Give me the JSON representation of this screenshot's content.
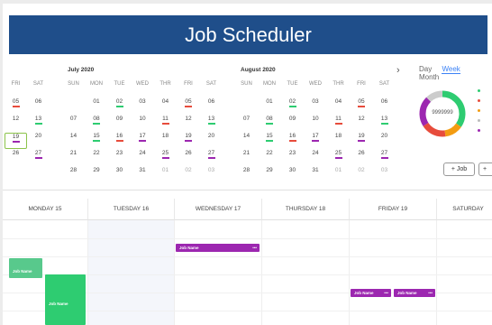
{
  "banner": {
    "title": "Job Scheduler"
  },
  "calendar": {
    "prev_partial_month": {
      "weekdays": [
        "FRI",
        "SAT"
      ],
      "rows": [
        [
          "05",
          "06"
        ],
        [
          "12",
          "13"
        ],
        [
          "19",
          "20"
        ],
        [
          "26",
          "27"
        ]
      ]
    },
    "july": {
      "title": "July 2020",
      "weekdays": [
        "SUN",
        "MON",
        "TUE",
        "WED",
        "THR",
        "FRI",
        "SAT"
      ],
      "rows": [
        [
          "",
          "01",
          "02",
          "03",
          "04",
          "05",
          "06"
        ],
        [
          "07",
          "08",
          "09",
          "10",
          "11",
          "12",
          "13"
        ],
        [
          "14",
          "15",
          "16",
          "17",
          "18",
          "19",
          "20"
        ],
        [
          "21",
          "22",
          "23",
          "24",
          "25",
          "26",
          "27"
        ],
        [
          "28",
          "29",
          "30",
          "31",
          "01",
          "02",
          "03"
        ]
      ]
    },
    "august": {
      "title": "August 2020",
      "weekdays": [
        "SUN",
        "MON",
        "TUE",
        "WED",
        "THR",
        "FRI",
        "SAT"
      ],
      "rows": [
        [
          "",
          "01",
          "02",
          "03",
          "04",
          "05",
          "06"
        ],
        [
          "07",
          "08",
          "09",
          "10",
          "11",
          "12",
          "13"
        ],
        [
          "14",
          "15",
          "16",
          "17",
          "18",
          "19",
          "20"
        ],
        [
          "21",
          "22",
          "23",
          "24",
          "25",
          "26",
          "27"
        ],
        [
          "28",
          "29",
          "30",
          "31",
          "01",
          "02",
          "03"
        ]
      ]
    },
    "next_arrow": "›"
  },
  "views": {
    "day": "Day",
    "week": "Week",
    "month": "Month",
    "active": "week"
  },
  "summary": {
    "donut_label": "9999999",
    "legend_colors": [
      "#2ecc71",
      "#e74c3c",
      "#f39c12",
      "#bbbbbb",
      "#9c27b0"
    ]
  },
  "actions": {
    "add_job": "+ Job",
    "add_other": "+"
  },
  "week": {
    "days": [
      "MONDAY 15",
      "TUESDAY 16",
      "WEDNESDAY 17",
      "THURSDAY 18",
      "FRIDAY 19",
      "SATURDAY"
    ],
    "events": [
      {
        "label": "Job Name",
        "more": "•••",
        "color": "#9c27b0"
      },
      {
        "label": "Job Name",
        "more": "",
        "color": "#58c98c"
      },
      {
        "label": "Job Name",
        "more": "",
        "color": "#2ecc71"
      },
      {
        "label": "Job Name",
        "more": "•••",
        "color": "#9c27b0"
      },
      {
        "label": "Job Name",
        "more": "•••",
        "color": "#9c27b0"
      }
    ]
  },
  "colors": {
    "banner": "#1f4e8a",
    "today_border": "#8bc34a",
    "event_purple": "#9c27b0",
    "event_green": "#2ecc71"
  }
}
